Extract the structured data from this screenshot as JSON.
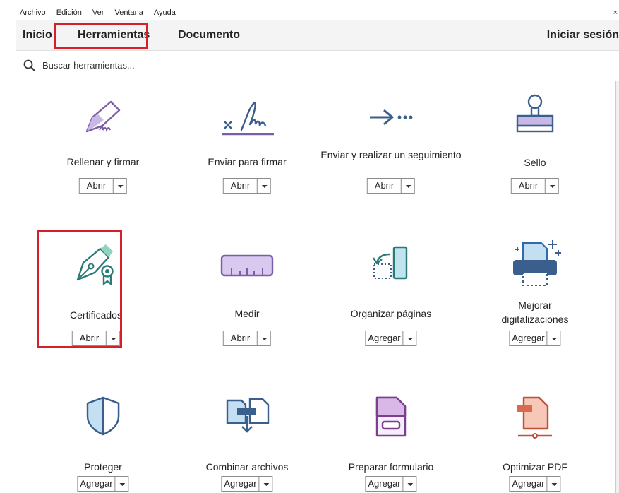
{
  "menubar": {
    "items": [
      "Archivo",
      "Edición",
      "Ver",
      "Ventana",
      "Ayuda"
    ],
    "close_glyph": "×"
  },
  "tabs": {
    "inicio": "Inicio",
    "herramientas": "Herramientas",
    "documento": "Documento",
    "login": "Iniciar sesión"
  },
  "search": {
    "placeholder": "Buscar herramientas..."
  },
  "tools": [
    {
      "name": "Rellenar y firmar",
      "action": "Abrir",
      "icon": "fill-sign-icon"
    },
    {
      "name": "Enviar para firmar",
      "action": "Abrir",
      "icon": "send-sign-icon"
    },
    {
      "name": "Enviar y realizar un seguimiento",
      "action": "Abrir",
      "icon": "send-track-icon"
    },
    {
      "name": "Sello",
      "action": "Abrir",
      "icon": "stamp-icon"
    },
    {
      "name": "Certificados",
      "action": "Abrir",
      "icon": "certificates-icon"
    },
    {
      "name": "Medir",
      "action": "Abrir",
      "icon": "ruler-icon"
    },
    {
      "name": "Organizar páginas",
      "action": "Agregar",
      "icon": "organize-pages-icon"
    },
    {
      "name": "Mejorar digitalizaciones",
      "action": "Agregar",
      "icon": "enhance-scans-icon"
    },
    {
      "name": "Proteger",
      "action": "Agregar",
      "icon": "shield-icon"
    },
    {
      "name": "Combinar archivos",
      "action": "Agregar",
      "icon": "combine-files-icon"
    },
    {
      "name": "Preparar formulario",
      "action": "Agregar",
      "icon": "prepare-form-icon"
    },
    {
      "name": "Optimizar PDF",
      "action": "Agregar",
      "icon": "optimize-pdf-icon"
    }
  ],
  "colors": {
    "highlight": "#d61f26",
    "purple": "#7b5ea7",
    "teal": "#2b7a78",
    "navy": "#3b5f8c"
  }
}
